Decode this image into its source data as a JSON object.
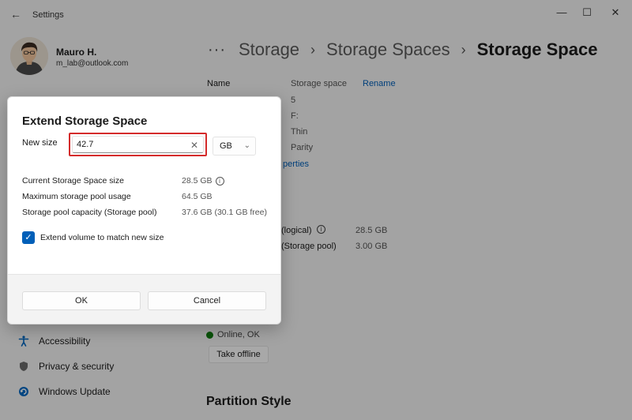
{
  "window": {
    "app_title": "Settings",
    "back_glyph": "←",
    "minimize_glyph": "—",
    "maximize_glyph": "☐",
    "close_glyph": "✕"
  },
  "user": {
    "name": "Mauro H.",
    "email": "m_lab@outlook.com"
  },
  "breadcrumb": {
    "more": "···",
    "separator": "›",
    "items": [
      "Storage",
      "Storage Spaces",
      "Storage Space"
    ]
  },
  "properties": {
    "name_key": "Name",
    "name_value": "Storage space",
    "rename_link": "Rename",
    "values": [
      "5",
      "F:",
      "Thin",
      "Parity"
    ],
    "properties_link_fragment": "perties",
    "logical_key_fragment": "(logical)",
    "logical_value": "28.5 GB",
    "pool_key_fragment": "(Storage pool)",
    "pool_value": "3.00 GB"
  },
  "nav": {
    "items": [
      {
        "label": "Accessibility",
        "icon": "accessibility-icon"
      },
      {
        "label": "Privacy & security",
        "icon": "shield-icon"
      },
      {
        "label": "Windows Update",
        "icon": "windows-update-icon"
      }
    ]
  },
  "status": {
    "text": "Online, OK",
    "take_offline": "Take offline"
  },
  "section": {
    "partition_style": "Partition Style"
  },
  "dialog": {
    "title": "Extend Storage Space",
    "size_label": "New size",
    "size_value": "42.7",
    "clear_glyph": "✕",
    "unit": "GB",
    "unit_chevron": "⌄",
    "info": [
      {
        "key": "Current Storage Space size",
        "value": "28.5 GB",
        "has_info_icon": true
      },
      {
        "key": "Maximum storage pool usage",
        "value": "64.5 GB"
      },
      {
        "key": "Storage pool capacity (Storage pool)",
        "value": "37.6 GB (30.1 GB free)"
      }
    ],
    "info_icon_glyph": "i",
    "checkbox_checked": true,
    "checkbox_glyph": "✓",
    "checkbox_label": "Extend volume to match new size",
    "ok_label": "OK",
    "cancel_label": "Cancel"
  },
  "colors": {
    "accent": "#005fb8",
    "highlight_border": "#d42b2b",
    "status_ok": "#107c10"
  }
}
